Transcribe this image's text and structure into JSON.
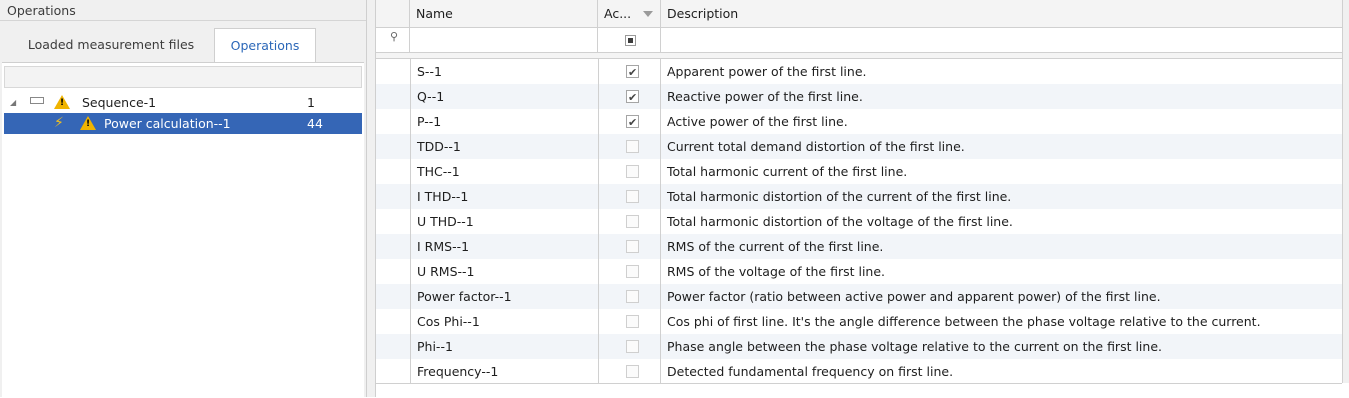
{
  "panel": {
    "title": "Operations"
  },
  "tabs": [
    {
      "label": "Loaded measurement files",
      "active": false
    },
    {
      "label": "Operations",
      "active": true
    }
  ],
  "tree": {
    "items": [
      {
        "label": "Sequence-1",
        "count": "1",
        "icon": "sequence-icon",
        "warning": true,
        "expanded": true
      },
      {
        "label": "Power calculation--1",
        "count": "44",
        "icon": "power-calculation-icon",
        "warning": true,
        "selected": true
      }
    ]
  },
  "grid": {
    "columns": {
      "name": "Name",
      "active": "Ac...",
      "description": "Description"
    },
    "rows": [
      {
        "name": "S--1",
        "active": true,
        "description": "Apparent power of the first line."
      },
      {
        "name": "Q--1",
        "active": true,
        "description": "Reactive power of the first line."
      },
      {
        "name": "P--1",
        "active": true,
        "description": "Active power of the first line."
      },
      {
        "name": "TDD--1",
        "active": false,
        "description": "Current total demand distortion of the first line."
      },
      {
        "name": "THC--1",
        "active": false,
        "description": "Total harmonic current of the first line."
      },
      {
        "name": "I THD--1",
        "active": false,
        "description": "Total harmonic distortion of the current of the first line."
      },
      {
        "name": "U THD--1",
        "active": false,
        "description": "Total harmonic distortion of the voltage of the first line."
      },
      {
        "name": "I RMS--1",
        "active": false,
        "description": "RMS of the current of the first line."
      },
      {
        "name": "U RMS--1",
        "active": false,
        "description": "RMS of the voltage of the first line."
      },
      {
        "name": "Power factor--1",
        "active": false,
        "description": "Power factor (ratio between active power and apparent power) of the first line."
      },
      {
        "name": "Cos Phi--1",
        "active": false,
        "description": "Cos phi of first line. It's the angle difference between the phase voltage relative to the current."
      },
      {
        "name": "Phi--1",
        "active": false,
        "description": "Phase angle between the phase voltage relative to the current on the first line."
      },
      {
        "name": "Frequency--1",
        "active": false,
        "description": "Detected fundamental frequency on first line."
      }
    ]
  },
  "colors": {
    "selection": "#3566b6",
    "active_tab_text": "#2b67b8",
    "warning": "#f0b400"
  }
}
